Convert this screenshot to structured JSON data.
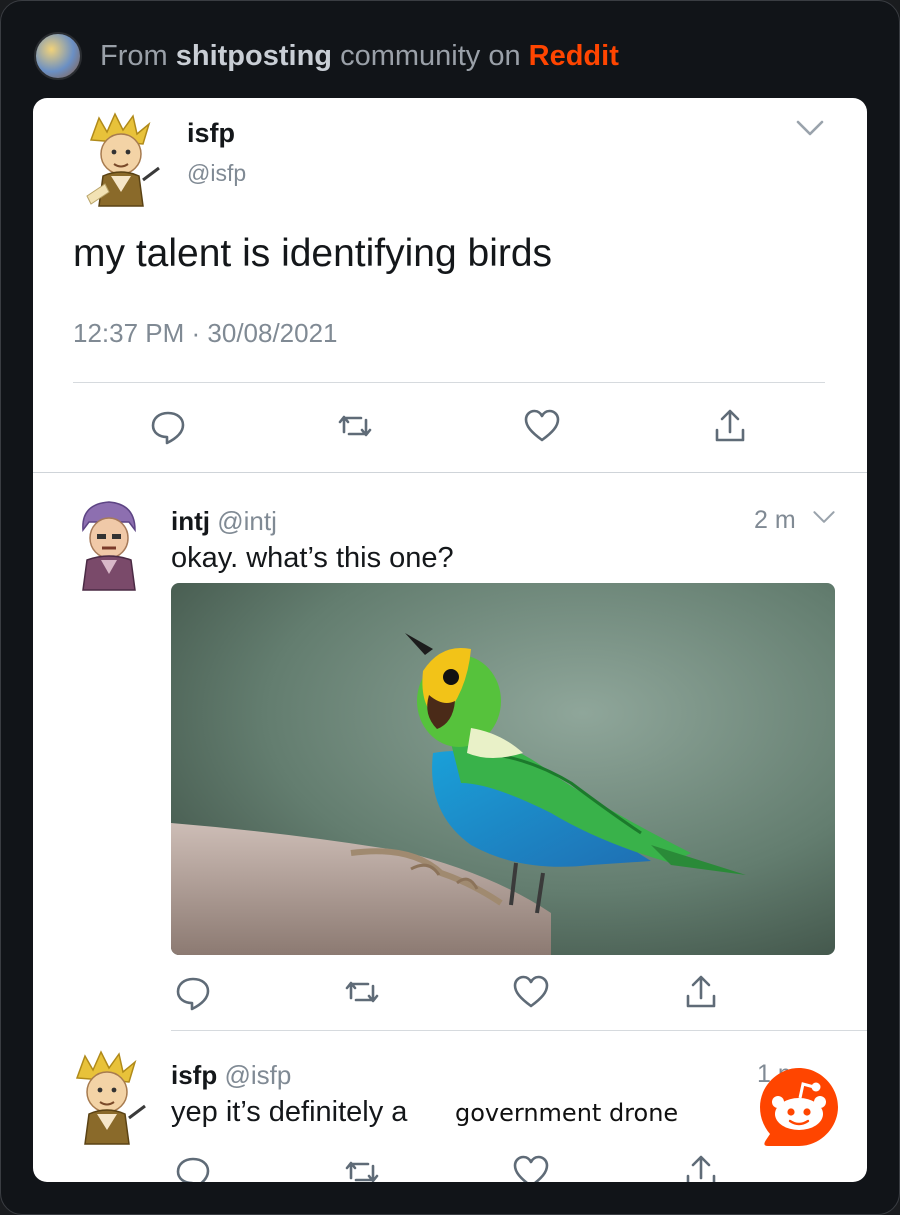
{
  "source": {
    "prefix": "From",
    "community": "shitposting",
    "middle": "community on",
    "platform": "Reddit",
    "accent": "#ff4500"
  },
  "main_tweet": {
    "name": "isfp",
    "handle": "@isfp",
    "text": "my talent is identifying birds",
    "timestamp": "12:37 PM · 30/08/2021",
    "menu_icon": "chevron-down-icon"
  },
  "reply_1": {
    "name": "intj",
    "handle": "@intj",
    "time": "2 m",
    "text": "okay. what’s this one?",
    "image_subject": "bird-photo"
  },
  "reply_2": {
    "name": "isfp",
    "handle": "@isfp",
    "time": "1 m",
    "text": "yep it’s definitely a",
    "overlay": "government drone"
  },
  "icons": [
    "reply-icon",
    "retweet-icon",
    "like-icon",
    "share-icon",
    "reddit-logo-icon"
  ],
  "colors": {
    "text": "#14171a",
    "muted": "#808a94",
    "icon": "#6b7682",
    "background": "#111418"
  }
}
